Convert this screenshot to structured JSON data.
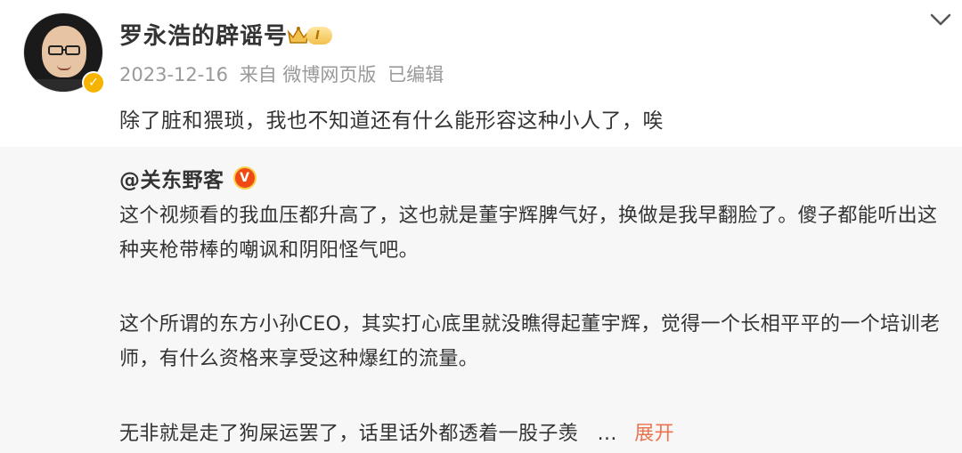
{
  "post": {
    "username": "罗永浩的辟谣号",
    "vip_level": "I",
    "date": "2023-12-16",
    "source": "来自 微博网页版",
    "edited": "已编辑",
    "text": "除了脏和猥琐，我也不知道还有什么能形容这种小人了，唉",
    "avatar_badge_icon": "verified-yellow-icon",
    "colors": {
      "meta": "#999999",
      "vip": "#f2c14e"
    }
  },
  "repost": {
    "mention": "@关东野客",
    "paragraph1": "这个视频看的我血压都升高了，这也就是董宇辉脾气好，换做是我早翻脸了。傻子都能听出这种夹枪带棒的嘲讽和阴阳怪气吧。",
    "paragraph2": "这个所谓的东方小孙CEO，其实打心底里就没瞧得起董宇辉，觉得一个长相平平的一个培训老师，有什么资格来享受这种爆红的流量。",
    "paragraph3": "无非就是走了狗屎运罢了，话里话外都透着一股子羡",
    "ellipsis": "...",
    "expand_label": "展开",
    "colors": {
      "background": "#f7f7f7",
      "expand": "#eb7350",
      "verified": "#f04a14"
    }
  }
}
